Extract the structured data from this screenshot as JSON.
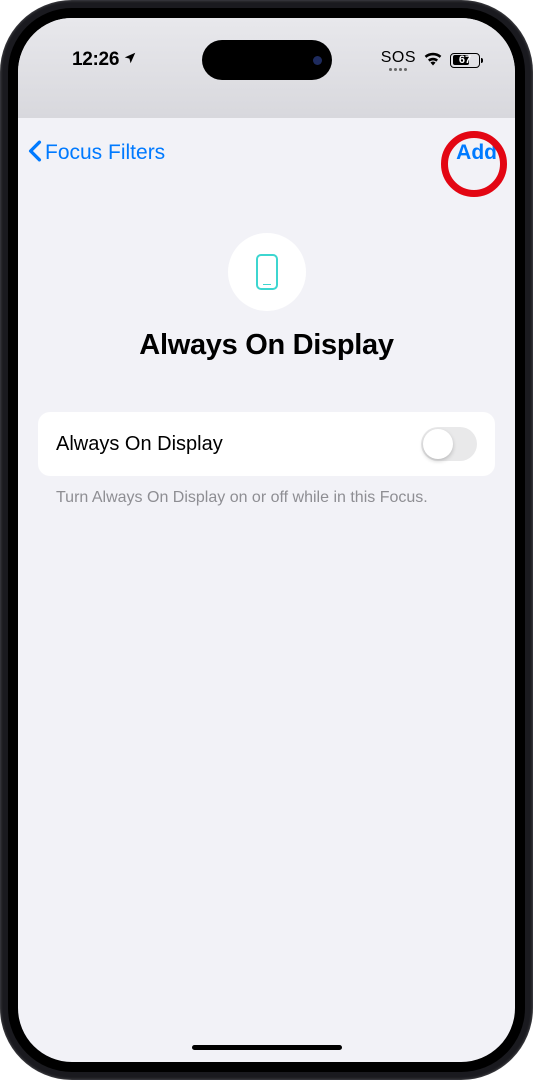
{
  "status_bar": {
    "time": "12:26",
    "sos": "SOS",
    "battery_level": "67"
  },
  "nav": {
    "back_label": "Focus Filters",
    "add_label": "Add"
  },
  "hero": {
    "title": "Always On Display"
  },
  "setting": {
    "label": "Always On Display",
    "toggle_on": false
  },
  "footer": {
    "text": "Turn Always On Display on or off while in this Focus."
  }
}
